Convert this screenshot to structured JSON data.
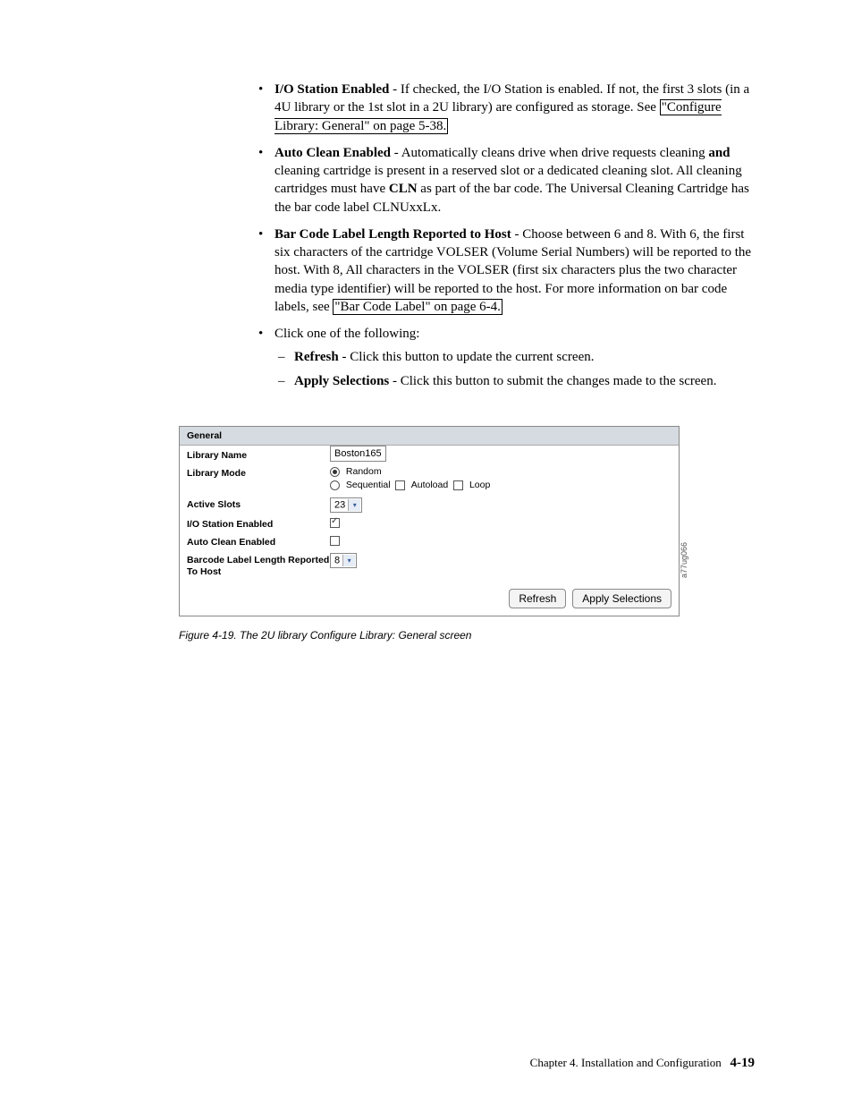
{
  "bullets": {
    "io_station": {
      "title": "I/O Station Enabled",
      "text1": " - If checked, the I/O Station is enabled. If not, the first 3 slots (in a 4U library or the 1st slot in a 2U library) are configured as storage. See ",
      "link": "\"Configure Library: General\" on page 5-38."
    },
    "auto_clean": {
      "title": "Auto Clean Enabled",
      "text1": " - Automatically cleans drive when drive requests cleaning ",
      "bold_and": "and",
      "text2": " cleaning cartridge is present in a reserved slot or a dedicated cleaning slot. All cleaning cartridges must have ",
      "bold_cln": "CLN",
      "text3": " as part of the bar code. The Universal Cleaning Cartridge has the bar code label CLNUxxLx."
    },
    "barcode": {
      "title": "Bar Code Label Length Reported to Host",
      "text1": " - Choose between 6 and 8. With 6, the first six characters of the cartridge VOLSER (Volume Serial Numbers) will be reported to the host. With 8, All characters in the VOLSER (first six characters plus the two character media type identifier) will be reported to the host. For more information on bar code labels, see ",
      "link": "\"Bar Code Label\" on page 6-4."
    },
    "click": {
      "text": "Click one of the following:",
      "refresh_title": "Refresh",
      "refresh_text": " - Click this button to update the current screen.",
      "apply_title": "Apply Selections",
      "apply_text": " - Click this button to submit the changes made to the screen."
    }
  },
  "fig": {
    "header": "General",
    "rows": {
      "library_name": {
        "label": "Library Name",
        "value": "Boston165"
      },
      "library_mode": {
        "label": "Library Mode",
        "random": "Random",
        "sequential": "Sequential",
        "autoload": "Autoload",
        "loop": "Loop"
      },
      "active_slots": {
        "label": "Active Slots",
        "value": "23"
      },
      "io_station": {
        "label": "I/O Station Enabled"
      },
      "auto_clean": {
        "label": "Auto Clean Enabled"
      },
      "barcode": {
        "label": "Barcode Label Length Reported To Host",
        "value": "8"
      }
    },
    "buttons": {
      "refresh": "Refresh",
      "apply": "Apply Selections"
    },
    "sidecode": "a77ug066"
  },
  "caption": "Figure 4-19. The 2U library Configure Library: General screen",
  "footer": {
    "chapter": "Chapter 4. Installation and Configuration",
    "page": "4-19"
  }
}
